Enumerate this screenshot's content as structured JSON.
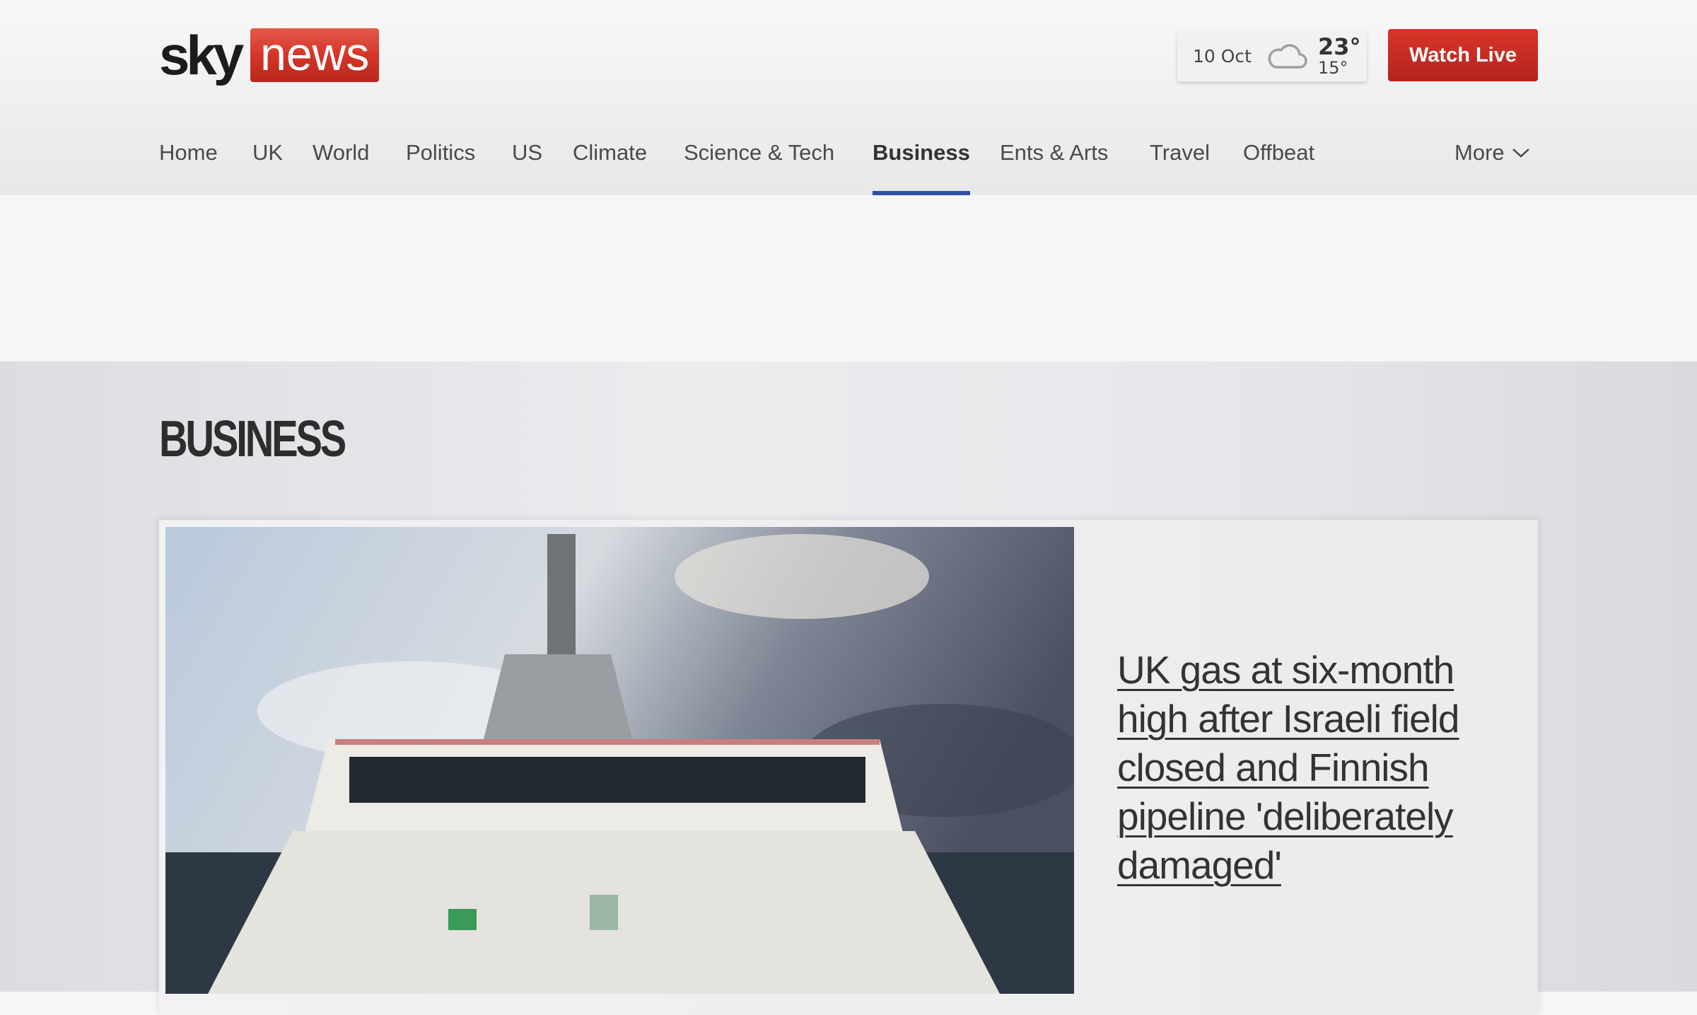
{
  "header": {
    "logo": {
      "sky": "sky",
      "news": "news"
    },
    "weather": {
      "date": "10 Oct",
      "icon": "cloud-icon",
      "high": "23°",
      "low": "15°"
    },
    "watch_live": "Watch Live"
  },
  "nav": {
    "items": [
      {
        "label": "Home"
      },
      {
        "label": "UK"
      },
      {
        "label": "World"
      },
      {
        "label": "Politics"
      },
      {
        "label": "US"
      },
      {
        "label": "Climate"
      },
      {
        "label": "Science & Tech"
      },
      {
        "label": "Business",
        "active": true
      },
      {
        "label": "Ents & Arts"
      },
      {
        "label": "Travel"
      },
      {
        "label": "Offbeat"
      }
    ],
    "more": "More"
  },
  "section": {
    "title": "BUSINESS"
  },
  "lead_story": {
    "headline": "UK gas at six-month high after Israeli field closed and Finnish pipeline 'deliberately damaged'",
    "image_alt": "ship-photo"
  },
  "colors": {
    "brand_red": "#d53528",
    "nav_active": "#2f4fa0"
  }
}
